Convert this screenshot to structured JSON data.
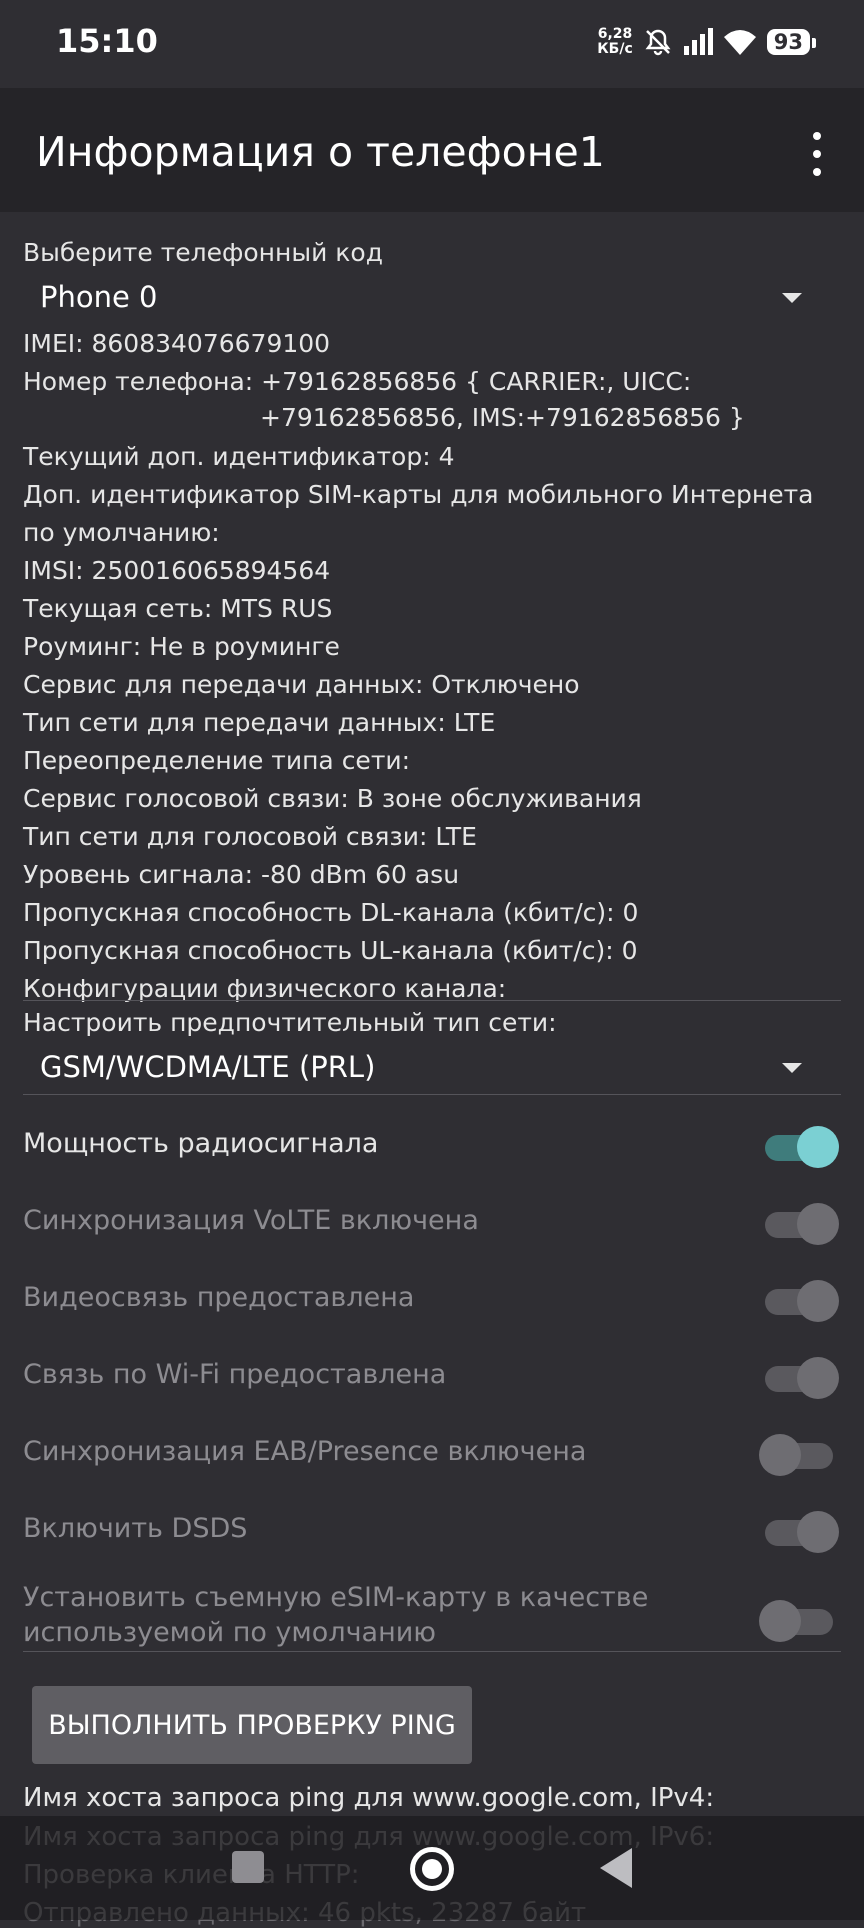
{
  "status_bar": {
    "time": "15:10",
    "net_speed_value": "6,28",
    "net_speed_unit": "КБ/с",
    "battery": "93",
    "icons": [
      "mute-bell-icon",
      "signal-icon",
      "wifi-icon",
      "battery-icon"
    ]
  },
  "app_bar": {
    "title": "Информация о телефоне1",
    "menu_icon": "more-vert-icon"
  },
  "phone_select": {
    "label": "Выберите телефонный код",
    "value": "Phone 0"
  },
  "info": [
    {
      "key": "IMEI:",
      "value": " 860834076679100"
    },
    {
      "key": "Номер телефона:",
      "value": " +79162856856 { CARRIER:, UICC:"
    },
    {
      "key": "",
      "value": "+79162856856, IMS:+79162856856 }"
    },
    {
      "key": "Текущий доп. идентификатор:",
      "value": " 4"
    },
    {
      "key": "Доп. идентификатор SIM-карты для мобильного Интернета",
      "value": ""
    },
    {
      "key": "по умолчанию:",
      "value": ""
    },
    {
      "key": "IMSI:",
      "value": " 250016065894564"
    },
    {
      "key": "Текущая сеть:",
      "value": " MTS RUS"
    },
    {
      "key": "Роуминг:",
      "value": " Не в роуминге"
    },
    {
      "key": "Сервис для передачи данных:",
      "value": " Отключено"
    },
    {
      "key": "Тип сети для передачи данных:",
      "value": " LTE"
    },
    {
      "key": "Переопределение типа сети:",
      "value": ""
    },
    {
      "key": "Сервис голосовой связи:",
      "value": " В зоне обслуживания"
    },
    {
      "key": "Тип сети для голосовой связи:",
      "value": " LTE"
    },
    {
      "key": "Уровень сигнала:",
      "value": " -80 dBm   60 asu"
    },
    {
      "key": "Пропускная способность DL-канала (кбит/с):",
      "value": " 0"
    },
    {
      "key": "Пропускная способность UL-канала (кбит/с):",
      "value": " 0"
    },
    {
      "key": "Конфигурации физического канала:",
      "value": ""
    }
  ],
  "network_type": {
    "label": "Настроить предпочтительный тип сети:",
    "value": "GSM/WCDMA/LTE (PRL)"
  },
  "toggles": [
    {
      "label": "Мощность радиосигнала",
      "state": "on",
      "enabled": true
    },
    {
      "label": "Синхронизация VoLTE включена",
      "state": "on",
      "enabled": false
    },
    {
      "label": "Видеосвязь предоставлена",
      "state": "on",
      "enabled": false
    },
    {
      "label": "Связь по Wi-Fi предоставлена",
      "state": "on",
      "enabled": false
    },
    {
      "label": "Синхронизация EAB/Presence включена",
      "state": "off",
      "enabled": false
    },
    {
      "label": "Включить DSDS",
      "state": "on",
      "enabled": false
    },
    {
      "label": "Установить съемную eSIM-карту в качестве",
      "label2": "используемой по умолчанию",
      "state": "off",
      "enabled": false
    }
  ],
  "ping_button": "ВЫПОЛНИТЬ ПРОВЕРКУ PING",
  "ping_results": [
    "Имя хоста запроса ping для www.google.com, IPv4:",
    "Имя хоста запроса ping для www.google.com, IPv6:",
    "Проверка клиента HTTP:",
    "Отправлено данных: 46 pkts, 23287 байт"
  ],
  "colors": {
    "background": "#2f2e33",
    "app_bar": "#252428",
    "accent": "#7bd0d3"
  }
}
